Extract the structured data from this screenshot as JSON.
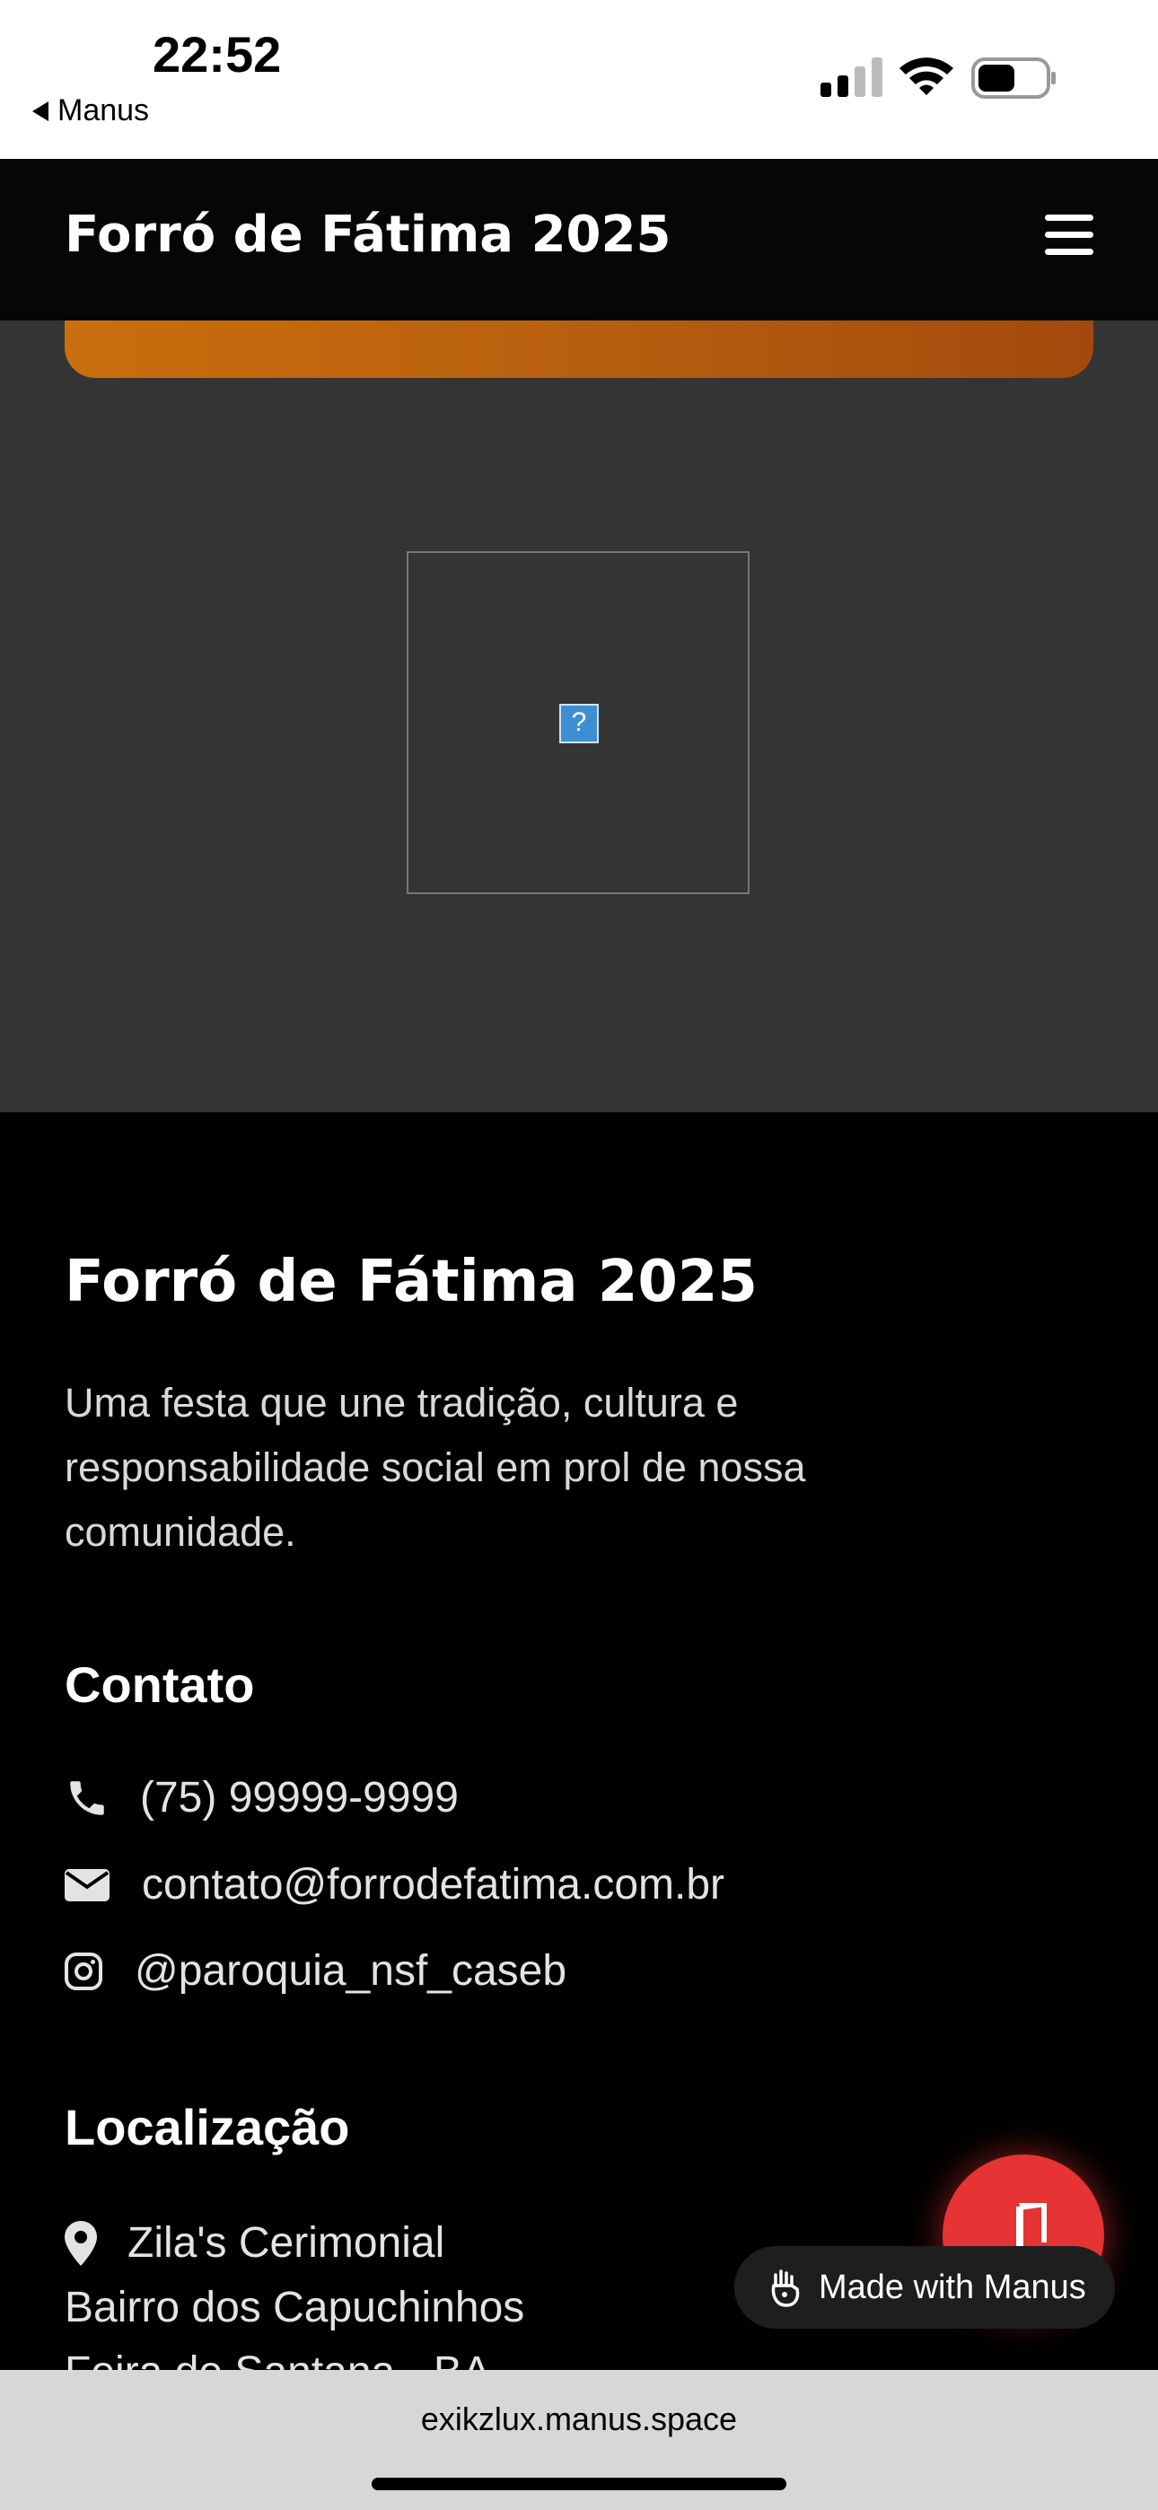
{
  "status_bar": {
    "time": "22:52",
    "back_app": "Manus"
  },
  "header": {
    "title": "Forró de Fátima 2025",
    "menu_icon": "hamburger-icon"
  },
  "content": {
    "image_icon": "broken-image-icon",
    "image_placeholder_glyph": "?"
  },
  "footer": {
    "title": "Forró de Fátima 2025",
    "description": "Uma festa que une tradição, cultura e responsabilidade social em prol de nossa comunidade.",
    "contact": {
      "heading": "Contato",
      "phone": "(75) 99999-9999",
      "email": "contato@forrodefatima.com.br",
      "instagram": "@paroquia_nsf_caseb"
    },
    "location": {
      "heading": "Localização",
      "venue": "Zila's Cerimonial",
      "neighborhood": "Bairro dos Capuchinhos",
      "city": "Feira de Santana - BA"
    }
  },
  "floating": {
    "music_icon": "music-note-icon",
    "badge_label": "Made with Manus"
  },
  "browser": {
    "url": "exikzlux.manus.space"
  },
  "colors": {
    "accent_orange": "#c96f0e",
    "fab_red": "#e53433",
    "section_gray": "#353435"
  }
}
